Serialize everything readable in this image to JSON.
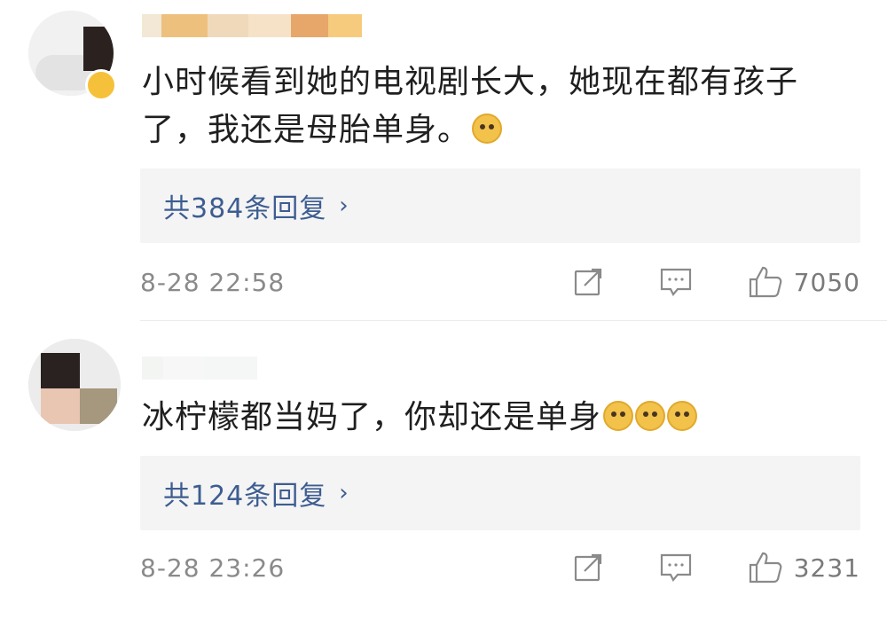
{
  "comments": [
    {
      "text_line1": "小时候看到她的电视剧长大，她现在都有孩子",
      "text_line2": "了，我还是母胎单身。",
      "emoji": "doge-emoji",
      "replies_label": "共384条回复",
      "replies_chevron": "›",
      "time": "8-28 22:58",
      "likes": "7050"
    },
    {
      "text_line1": "冰柠檬都当妈了，你却还是单身",
      "emoji": "doge-emoji",
      "replies_label": "共124条回复",
      "replies_chevron": "›",
      "time": "8-28 23:26",
      "likes": "3231"
    }
  ],
  "icons": {
    "share": "share-icon",
    "comment": "comment-icon",
    "like": "thumbs-up-icon"
  },
  "colors": {
    "link": "#3d5d91",
    "meta": "#8a8a8a",
    "reply_bg": "#f4f4f4",
    "badge": "#f6c13a"
  }
}
